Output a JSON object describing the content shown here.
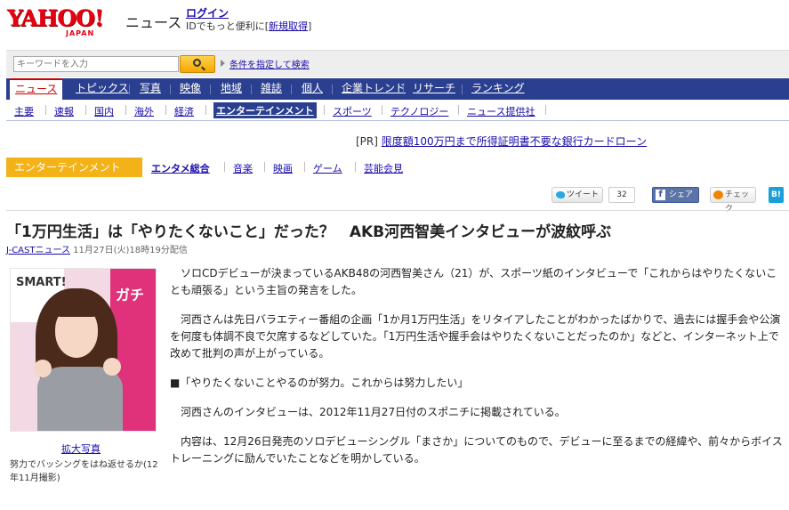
{
  "header": {
    "logo_text": "YAHOO!",
    "logo_sub": "JAPAN",
    "service_name": "ニュース",
    "login_label": "ログイン",
    "login_sub_prefix": "IDでもっと便利に[",
    "register_label": "新規取得",
    "login_sub_suffix": "]"
  },
  "search": {
    "placeholder": "キーワードを入力",
    "button_icon": "search-icon",
    "condition_link": "条件を指定して検索"
  },
  "main_nav": {
    "tabs": [
      "ニュース",
      "トピックス",
      "写真",
      "映像",
      "地域",
      "雑誌",
      "個人",
      "企業トレンド",
      "リサーチ",
      "ランキング"
    ],
    "active_index": 0
  },
  "sub_nav": {
    "items": [
      "主要",
      "速報",
      "国内",
      "海外",
      "経済",
      "エンターテインメント",
      "スポーツ",
      "テクノロジー",
      "ニュース提供社"
    ],
    "active_index": 5
  },
  "pr": {
    "prefix": "[PR]",
    "link": "限度額100万円まで所得証明書不要な銀行カードローン"
  },
  "category": {
    "label": "エンターテインメント",
    "items": [
      "エンタメ総合",
      "音楽",
      "映画",
      "ゲーム",
      "芸能会見"
    ],
    "bold_index": 0
  },
  "share": {
    "tweet_label": "ツイート",
    "tweet_count": "32",
    "facebook_label": "シェア",
    "facebook_icon": "f",
    "check_label": "チェック",
    "hatena_label": "B!"
  },
  "article": {
    "headline": "「1万円生活」は「やりたくないこと」だった？　AKB河西智美インタビューが波紋呼ぶ",
    "source": "J-CASTニュース",
    "date": "11月27日(火)18時19分配信",
    "photo": {
      "sign_text": "SMART!",
      "sign_right_text": "ガチ",
      "enlarge_label": "拡大写真",
      "caption": "努力でバッシングをはね返せるか(12年11月撮影)"
    },
    "paragraphs": [
      "ソロCDデビューが決まっているAKB48の河西智美さん（21）が、スポーツ紙のインタビューで「これからはやりたくないことも頑張る」という主旨の発言をした。",
      "河西さんは先日バラエティー番組の企画「1か月1万円生活」をリタイアしたことがわかったばかりで、過去には握手会や公演を何度も体調不良で欠席するなどしていた。「1万円生活や握手会はやりたくないことだったのか」などと、インターネット上で改めて批判の声が上がっている。",
      "■「やりたくないことやるのが努力。これからは努力したい」",
      "河西さんのインタビューは、2012年11月27日付のスポニチに掲載されている。",
      "内容は、12月26日発売のソロデビューシングル「まさか」についてのもので、デビューに至るまでの経緯や、前々からボイストレーニングに励んでいたことなどを明かしている。"
    ]
  },
  "colors": {
    "nav_bg": "#2a3f8f",
    "link": "#1a0dab",
    "category_bg": "#f3b318",
    "logo_red": "#e60012"
  }
}
